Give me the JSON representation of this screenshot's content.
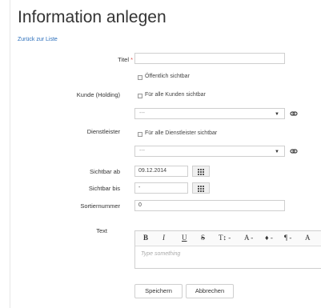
{
  "page": {
    "title": "Information anlegen",
    "back_link": "Zurück zur Liste"
  },
  "form": {
    "title_label": "Titel",
    "required_marker": "*",
    "public_checkbox": "Öffentlich sichtbar",
    "customer_label": "Kunde (Holding)",
    "customer_all_checkbox": "Für alle Kunden sichtbar",
    "customer_select": "---",
    "provider_label": "Dienstleister",
    "provider_all_checkbox": "Für alle Dienstleister sichtbar",
    "provider_select": "---",
    "visible_from_label": "Sichtbar ab",
    "visible_from_value": "09.12.2014",
    "visible_to_label": "Sichtbar bis",
    "visible_to_value": "-",
    "sort_label": "Sortiernummer",
    "sort_value": "0",
    "text_label": "Text",
    "text_placeholder": "Type something",
    "toolbar": {
      "bold": "B",
      "italic": "I",
      "underline": "U",
      "strike": "S",
      "size": "T↕ -",
      "font": "A -",
      "color": "♦ -",
      "paragraph": "¶ -",
      "more": "A"
    }
  },
  "buttons": {
    "save": "Speichern",
    "cancel": "Abbrechen"
  },
  "colors": {
    "link": "#2a6ebb",
    "required": "#d9534f",
    "border": "#cfcfcf"
  }
}
